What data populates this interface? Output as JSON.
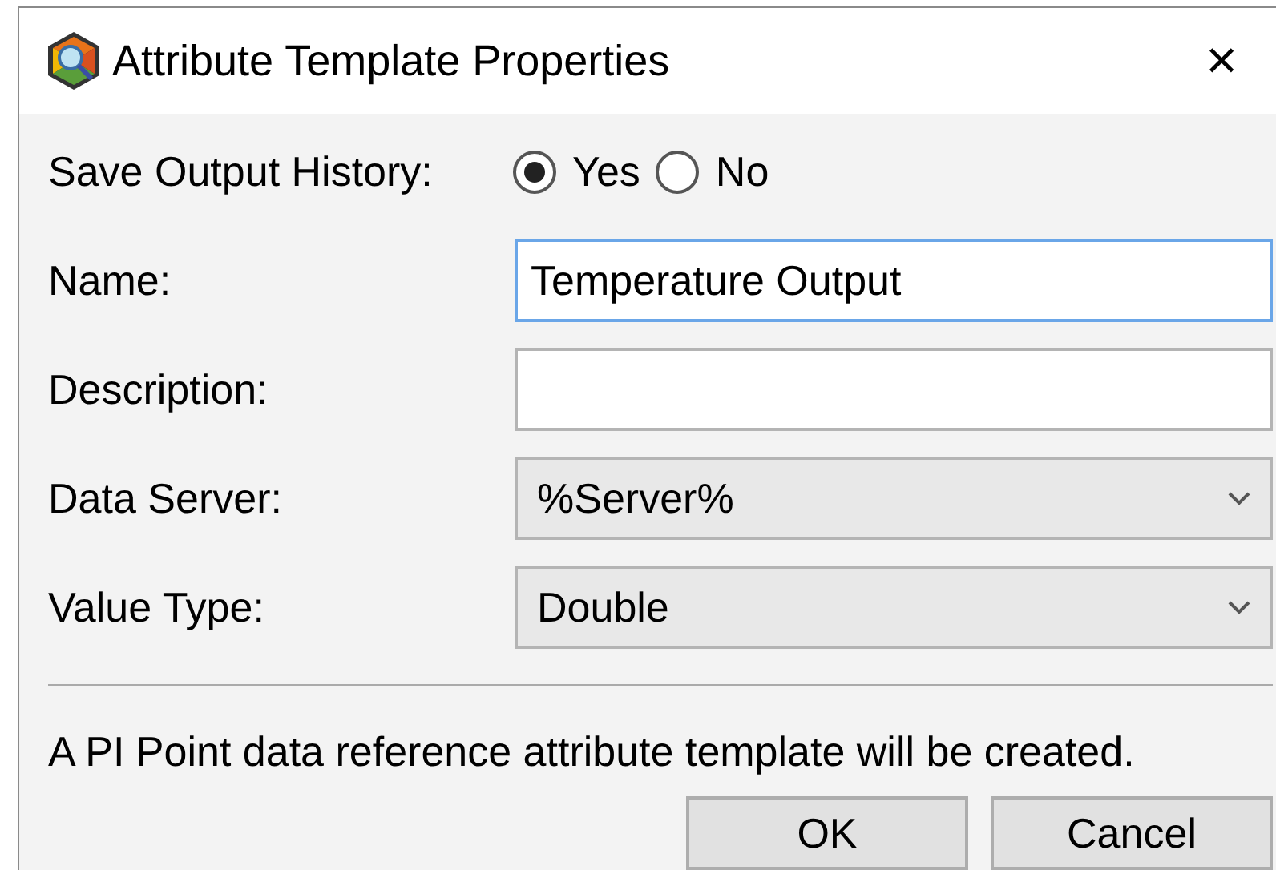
{
  "window": {
    "title": "Attribute Template Properties",
    "close": "×"
  },
  "history": {
    "label": "Save Output History:",
    "options": [
      {
        "label": "Yes",
        "selected": true
      },
      {
        "label": "No",
        "selected": false
      }
    ]
  },
  "fields": [
    {
      "kind": "text",
      "label": "Name:",
      "value": "Temperature Output",
      "focused": true
    },
    {
      "kind": "text",
      "label": "Description:",
      "focused": false
    },
    {
      "kind": "select",
      "label": "Data Server:",
      "value": "%Server%"
    },
    {
      "kind": "select",
      "label": "Value Type:",
      "value": "Double"
    }
  ],
  "message": "A PI Point data reference attribute template will be created.",
  "buttons": [
    "OK",
    "Cancel"
  ]
}
